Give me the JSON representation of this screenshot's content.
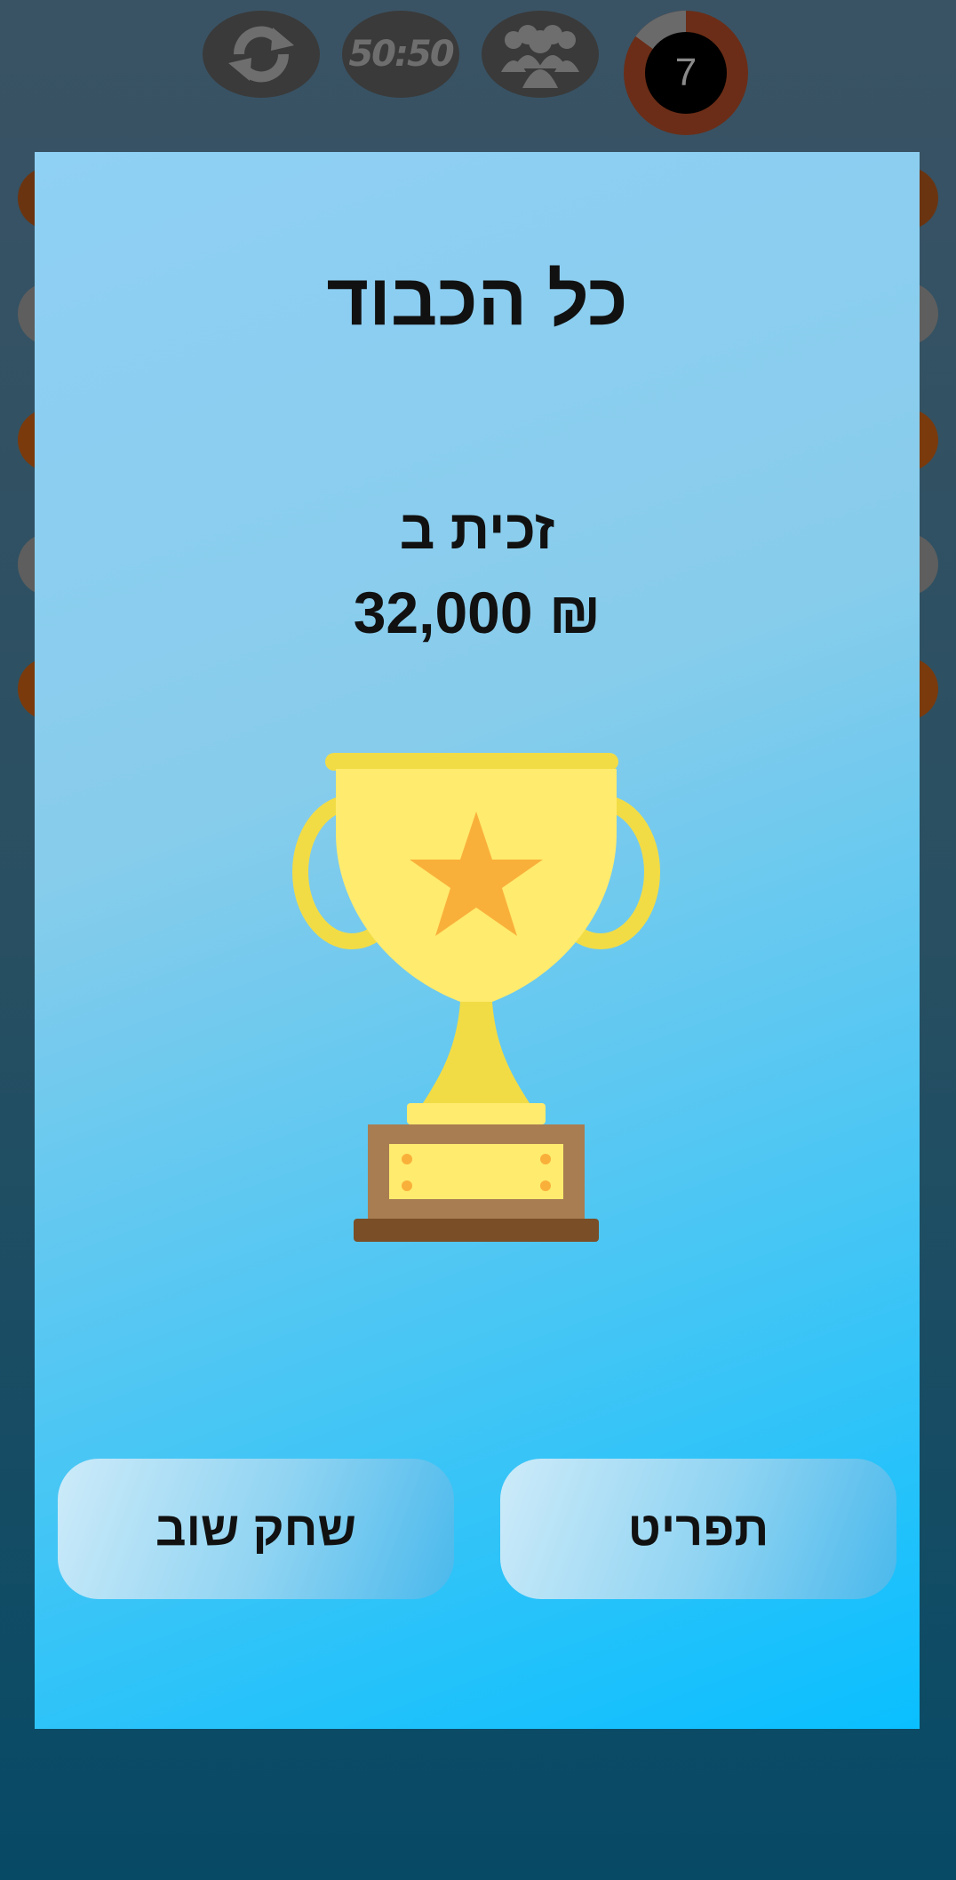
{
  "game": {
    "lifelines": [
      {
        "name": "switch-question",
        "icon": "refresh-icon"
      },
      {
        "name": "fifty-fifty",
        "label": "50:50"
      },
      {
        "name": "ask-audience",
        "icon": "people-icon"
      }
    ],
    "timer": {
      "value": "7",
      "fraction_elapsed": 0.15
    }
  },
  "dialog": {
    "title": "כל הכבוד",
    "won_label": "זכית ב",
    "prize": "₪ 32,000",
    "trophy_icon": "trophy-icon",
    "buttons": {
      "menu": "תפריט",
      "play_again": "שחק שוב"
    }
  },
  "colors": {
    "modal_top": "#8fd0f5",
    "modal_bottom": "#0abfff",
    "trophy_gold": "#ffeb6e",
    "star": "#f9b03a",
    "timer_ring": "#6b2d17"
  }
}
